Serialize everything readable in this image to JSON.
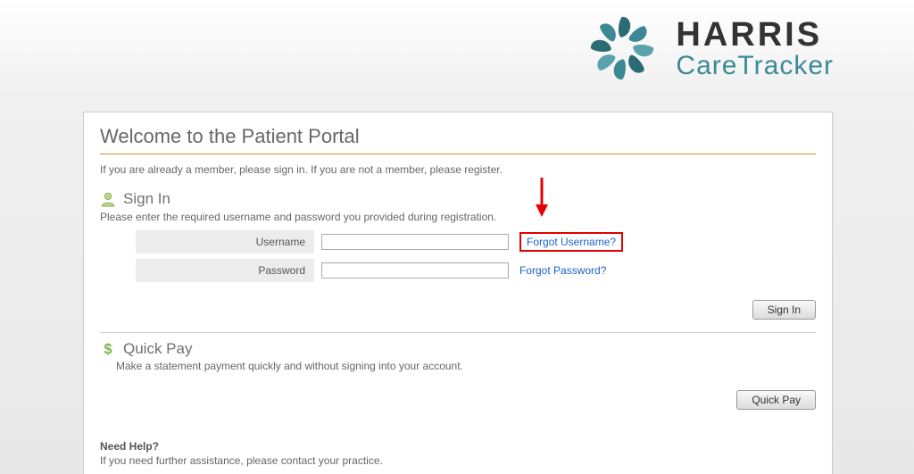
{
  "brand": {
    "name_main": "HARRIS",
    "name_sub": "CareTracker"
  },
  "panel": {
    "title": "Welcome to the Patient Portal",
    "subtitle": "If you are already a member, please sign in. If you are not a member, please register."
  },
  "signin": {
    "heading": "Sign In",
    "instructions": "Please enter the required username and password you provided during registration.",
    "username_label": "Username",
    "password_label": "Password",
    "forgot_username": "Forgot Username?",
    "forgot_password": "Forgot Password?",
    "button": "Sign In"
  },
  "quickpay": {
    "heading": "Quick Pay",
    "sub": "Make a statement payment quickly and without signing into your account.",
    "button": "Quick Pay"
  },
  "help": {
    "heading": "Need Help?",
    "sub": "If you need further assistance, please contact your practice."
  }
}
